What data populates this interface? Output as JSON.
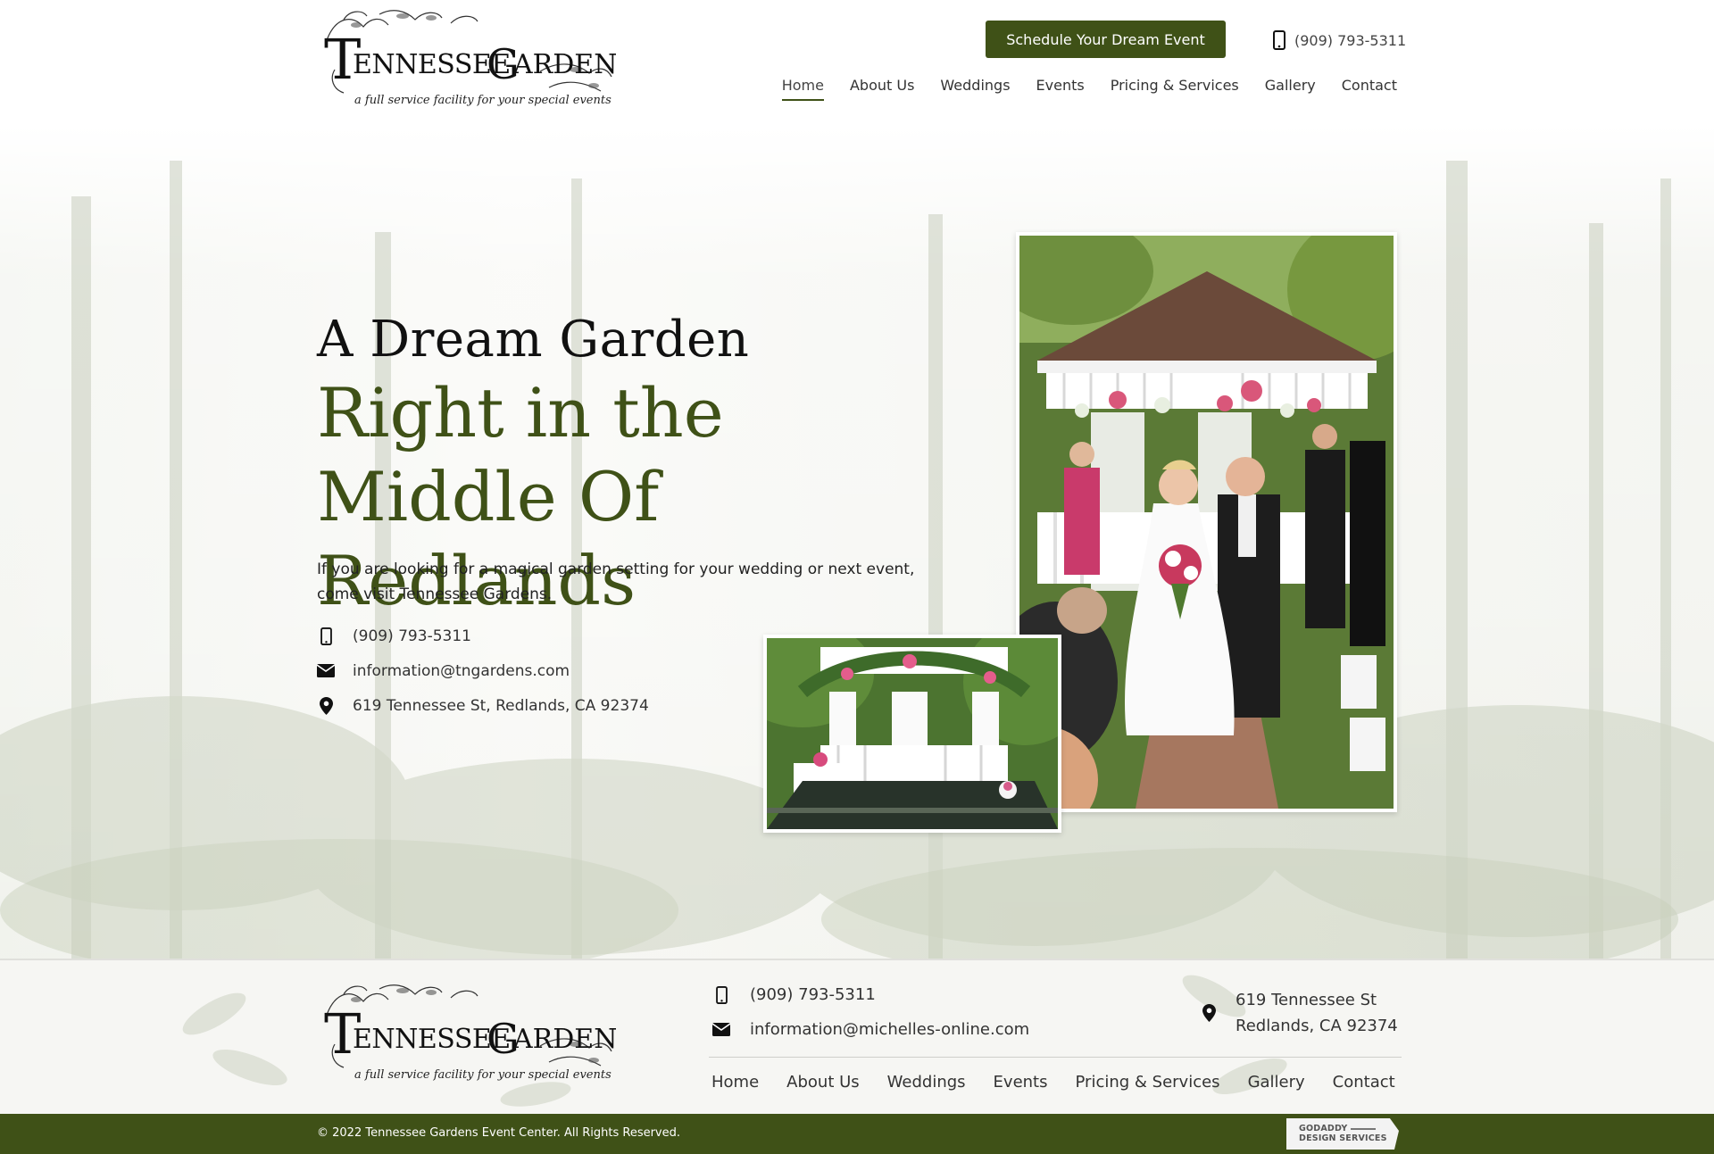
{
  "header": {
    "logo": {
      "name": "TENNESSEE GARDENS",
      "tagline": "a full service facility for your special events"
    },
    "cta_label": "Schedule Your Dream Event",
    "phone": "(909) 793-5311",
    "nav": [
      {
        "label": "Home",
        "active": true
      },
      {
        "label": "About Us",
        "active": false
      },
      {
        "label": "Weddings",
        "active": false
      },
      {
        "label": "Events",
        "active": false
      },
      {
        "label": "Pricing & Services",
        "active": false
      },
      {
        "label": "Gallery",
        "active": false
      },
      {
        "label": "Contact",
        "active": false
      }
    ]
  },
  "hero": {
    "title_line1": "A Dream Garden",
    "title_line2": "Right in the Middle Of Redlands",
    "description": "If you are looking for a magical garden setting for your wedding or next event, come visit Tennessee Gardens.",
    "phone": "(909) 793-5311",
    "email": "information@tngardens.com",
    "address": "619 Tennessee St, Redlands, CA 92374"
  },
  "footer": {
    "phone": "(909) 793-5311",
    "email": "information@michelles-online.com",
    "address_line1": "619 Tennessee St",
    "address_line2": "Redlands, CA 92374",
    "nav": [
      "Home",
      "About Us",
      "Weddings",
      "Events",
      "Pricing & Services",
      "Gallery",
      "Contact"
    ]
  },
  "bottom_bar": {
    "copyright": "© 2022 Tennessee Gardens Event Center. All Rights Reserved.",
    "badge_line1": "GODADDY",
    "badge_line2": "DESIGN SERVICES"
  },
  "colors": {
    "brand_green": "#3f5117",
    "text_dark": "#222222",
    "background": "#ffffff"
  },
  "icons": [
    "phone-icon",
    "envelope-icon",
    "map-pin-icon"
  ]
}
